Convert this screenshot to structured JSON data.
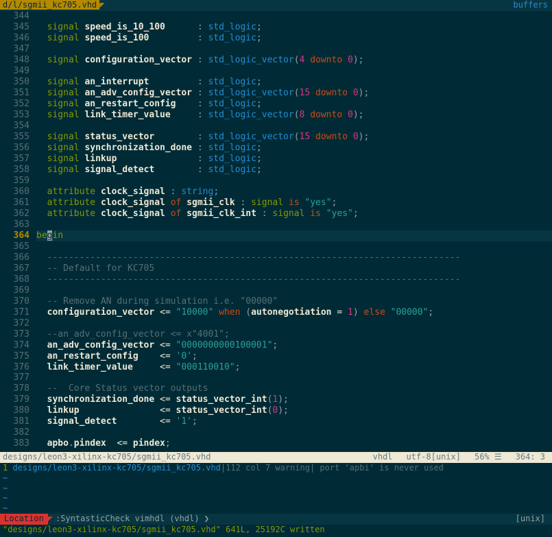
{
  "topbar": {
    "tab_label": "d/l/sgmii_kc705.vhd",
    "buffers_label": "buffers"
  },
  "lines": [
    {
      "n": 344,
      "seg": []
    },
    {
      "n": 345,
      "seg": [
        {
          "t": "  ",
          "c": ""
        },
        {
          "t": "signal",
          "c": "kw"
        },
        {
          "t": " ",
          "c": ""
        },
        {
          "t": "speed_is_10_100",
          "c": "ident"
        },
        {
          "t": "      : ",
          "c": "punc"
        },
        {
          "t": "std_logic",
          "c": "type"
        },
        {
          "t": ";",
          "c": "punc"
        }
      ]
    },
    {
      "n": 346,
      "seg": [
        {
          "t": "  ",
          "c": ""
        },
        {
          "t": "signal",
          "c": "kw"
        },
        {
          "t": " ",
          "c": ""
        },
        {
          "t": "speed_is_100",
          "c": "ident"
        },
        {
          "t": "         : ",
          "c": "punc"
        },
        {
          "t": "std_logic",
          "c": "type"
        },
        {
          "t": ";",
          "c": "punc"
        }
      ]
    },
    {
      "n": 347,
      "seg": []
    },
    {
      "n": 348,
      "seg": [
        {
          "t": "  ",
          "c": ""
        },
        {
          "t": "signal",
          "c": "kw"
        },
        {
          "t": " ",
          "c": ""
        },
        {
          "t": "configuration_vector",
          "c": "ident"
        },
        {
          "t": " : ",
          "c": "punc"
        },
        {
          "t": "std_logic_vector",
          "c": "type"
        },
        {
          "t": "(",
          "c": "punc"
        },
        {
          "t": "4",
          "c": "num"
        },
        {
          "t": " ",
          "c": ""
        },
        {
          "t": "downto",
          "c": "kw2"
        },
        {
          "t": " ",
          "c": ""
        },
        {
          "t": "0",
          "c": "num"
        },
        {
          "t": ");",
          "c": "punc"
        }
      ]
    },
    {
      "n": 349,
      "seg": []
    },
    {
      "n": 350,
      "seg": [
        {
          "t": "  ",
          "c": ""
        },
        {
          "t": "signal",
          "c": "kw"
        },
        {
          "t": " ",
          "c": ""
        },
        {
          "t": "an_interrupt",
          "c": "ident"
        },
        {
          "t": "         : ",
          "c": "punc"
        },
        {
          "t": "std_logic",
          "c": "type"
        },
        {
          "t": ";",
          "c": "punc"
        }
      ]
    },
    {
      "n": 351,
      "seg": [
        {
          "t": "  ",
          "c": ""
        },
        {
          "t": "signal",
          "c": "kw"
        },
        {
          "t": " ",
          "c": ""
        },
        {
          "t": "an_adv_config_vector",
          "c": "ident"
        },
        {
          "t": " : ",
          "c": "punc"
        },
        {
          "t": "std_logic_vector",
          "c": "type"
        },
        {
          "t": "(",
          "c": "punc"
        },
        {
          "t": "15",
          "c": "num"
        },
        {
          "t": " ",
          "c": ""
        },
        {
          "t": "downto",
          "c": "kw2"
        },
        {
          "t": " ",
          "c": ""
        },
        {
          "t": "0",
          "c": "num"
        },
        {
          "t": ");",
          "c": "punc"
        }
      ]
    },
    {
      "n": 352,
      "seg": [
        {
          "t": "  ",
          "c": ""
        },
        {
          "t": "signal",
          "c": "kw"
        },
        {
          "t": " ",
          "c": ""
        },
        {
          "t": "an_restart_config",
          "c": "ident"
        },
        {
          "t": "    : ",
          "c": "punc"
        },
        {
          "t": "std_logic",
          "c": "type"
        },
        {
          "t": ";",
          "c": "punc"
        }
      ]
    },
    {
      "n": 353,
      "seg": [
        {
          "t": "  ",
          "c": ""
        },
        {
          "t": "signal",
          "c": "kw"
        },
        {
          "t": " ",
          "c": ""
        },
        {
          "t": "link_timer_value",
          "c": "ident"
        },
        {
          "t": "     : ",
          "c": "punc"
        },
        {
          "t": "std_logic_vector",
          "c": "type"
        },
        {
          "t": "(",
          "c": "punc"
        },
        {
          "t": "8",
          "c": "num"
        },
        {
          "t": " ",
          "c": ""
        },
        {
          "t": "downto",
          "c": "kw2"
        },
        {
          "t": " ",
          "c": ""
        },
        {
          "t": "0",
          "c": "num"
        },
        {
          "t": ");",
          "c": "punc"
        }
      ]
    },
    {
      "n": 354,
      "seg": []
    },
    {
      "n": 355,
      "seg": [
        {
          "t": "  ",
          "c": ""
        },
        {
          "t": "signal",
          "c": "kw"
        },
        {
          "t": " ",
          "c": ""
        },
        {
          "t": "status_vector",
          "c": "ident"
        },
        {
          "t": "        : ",
          "c": "punc"
        },
        {
          "t": "std_logic_vector",
          "c": "type"
        },
        {
          "t": "(",
          "c": "punc"
        },
        {
          "t": "15",
          "c": "num"
        },
        {
          "t": " ",
          "c": ""
        },
        {
          "t": "downto",
          "c": "kw2"
        },
        {
          "t": " ",
          "c": ""
        },
        {
          "t": "0",
          "c": "num"
        },
        {
          "t": ");",
          "c": "punc"
        }
      ]
    },
    {
      "n": 356,
      "seg": [
        {
          "t": "  ",
          "c": ""
        },
        {
          "t": "signal",
          "c": "kw"
        },
        {
          "t": " ",
          "c": ""
        },
        {
          "t": "synchronization_done",
          "c": "ident"
        },
        {
          "t": " : ",
          "c": "punc"
        },
        {
          "t": "std_logic",
          "c": "type"
        },
        {
          "t": ";",
          "c": "punc"
        }
      ]
    },
    {
      "n": 357,
      "seg": [
        {
          "t": "  ",
          "c": ""
        },
        {
          "t": "signal",
          "c": "kw"
        },
        {
          "t": " ",
          "c": ""
        },
        {
          "t": "linkup",
          "c": "ident"
        },
        {
          "t": "               : ",
          "c": "punc"
        },
        {
          "t": "std_logic",
          "c": "type"
        },
        {
          "t": ";",
          "c": "punc"
        }
      ]
    },
    {
      "n": 358,
      "seg": [
        {
          "t": "  ",
          "c": ""
        },
        {
          "t": "signal",
          "c": "kw"
        },
        {
          "t": " ",
          "c": ""
        },
        {
          "t": "signal_detect",
          "c": "ident"
        },
        {
          "t": "        : ",
          "c": "punc"
        },
        {
          "t": "std_logic",
          "c": "type"
        },
        {
          "t": ";",
          "c": "punc"
        }
      ]
    },
    {
      "n": 359,
      "seg": []
    },
    {
      "n": 360,
      "seg": [
        {
          "t": "  ",
          "c": ""
        },
        {
          "t": "attribute",
          "c": "kw"
        },
        {
          "t": " ",
          "c": ""
        },
        {
          "t": "clock_signal",
          "c": "ident"
        },
        {
          "t": " : ",
          "c": "punc"
        },
        {
          "t": "string",
          "c": "type"
        },
        {
          "t": ";",
          "c": "punc"
        }
      ]
    },
    {
      "n": 361,
      "seg": [
        {
          "t": "  ",
          "c": ""
        },
        {
          "t": "attribute",
          "c": "kw"
        },
        {
          "t": " ",
          "c": ""
        },
        {
          "t": "clock_signal",
          "c": "ident"
        },
        {
          "t": " ",
          "c": ""
        },
        {
          "t": "of",
          "c": "kw2"
        },
        {
          "t": " ",
          "c": ""
        },
        {
          "t": "sgmii_clk",
          "c": "ident"
        },
        {
          "t": " : ",
          "c": "punc"
        },
        {
          "t": "signal",
          "c": "kw"
        },
        {
          "t": " ",
          "c": ""
        },
        {
          "t": "is",
          "c": "kw2"
        },
        {
          "t": " ",
          "c": ""
        },
        {
          "t": "\"yes\"",
          "c": "str"
        },
        {
          "t": ";",
          "c": "punc"
        }
      ]
    },
    {
      "n": 362,
      "seg": [
        {
          "t": "  ",
          "c": ""
        },
        {
          "t": "attribute",
          "c": "kw"
        },
        {
          "t": " ",
          "c": ""
        },
        {
          "t": "clock_signal",
          "c": "ident"
        },
        {
          "t": " ",
          "c": ""
        },
        {
          "t": "of",
          "c": "kw2"
        },
        {
          "t": " ",
          "c": ""
        },
        {
          "t": "sgmii_clk_int",
          "c": "ident"
        },
        {
          "t": " : ",
          "c": "punc"
        },
        {
          "t": "signal",
          "c": "kw"
        },
        {
          "t": " ",
          "c": ""
        },
        {
          "t": "is",
          "c": "kw2"
        },
        {
          "t": " ",
          "c": ""
        },
        {
          "t": "\"yes\"",
          "c": "str"
        },
        {
          "t": ";",
          "c": "punc"
        }
      ]
    },
    {
      "n": 363,
      "seg": []
    },
    {
      "n": 364,
      "current": true,
      "seg": [
        {
          "t": "be",
          "c": "kw"
        },
        {
          "t": "g",
          "c": "cursor"
        },
        {
          "t": "in",
          "c": "kw"
        }
      ]
    },
    {
      "n": 365,
      "seg": []
    },
    {
      "n": 366,
      "seg": [
        {
          "t": "  -----------------------------------------------------------------------------",
          "c": "comment"
        }
      ]
    },
    {
      "n": 367,
      "seg": [
        {
          "t": "  -- Default for KC705",
          "c": "comment"
        }
      ]
    },
    {
      "n": 368,
      "seg": [
        {
          "t": "  -----------------------------------------------------------------------------",
          "c": "comment"
        }
      ]
    },
    {
      "n": 369,
      "seg": []
    },
    {
      "n": 370,
      "seg": [
        {
          "t": "  -- Remove AN during simulation i.e. \"00000\"",
          "c": "comment"
        }
      ]
    },
    {
      "n": 371,
      "seg": [
        {
          "t": "  ",
          "c": ""
        },
        {
          "t": "configuration_vector",
          "c": "ident"
        },
        {
          "t": " <= ",
          "c": "op"
        },
        {
          "t": "\"10000\"",
          "c": "str"
        },
        {
          "t": " ",
          "c": ""
        },
        {
          "t": "when",
          "c": "kw2"
        },
        {
          "t": " (",
          "c": "punc"
        },
        {
          "t": "autonegotiation",
          "c": "ident"
        },
        {
          "t": " = ",
          "c": "op"
        },
        {
          "t": "1",
          "c": "num"
        },
        {
          "t": ") ",
          "c": "punc"
        },
        {
          "t": "else",
          "c": "kw2"
        },
        {
          "t": " ",
          "c": ""
        },
        {
          "t": "\"00000\"",
          "c": "str"
        },
        {
          "t": ";",
          "c": "punc"
        }
      ]
    },
    {
      "n": 372,
      "seg": []
    },
    {
      "n": 373,
      "seg": [
        {
          "t": "  --an_adv_config_vector <= x\"4001\";",
          "c": "comment"
        }
      ]
    },
    {
      "n": 374,
      "seg": [
        {
          "t": "  ",
          "c": ""
        },
        {
          "t": "an_adv_config_vector",
          "c": "ident"
        },
        {
          "t": " <= ",
          "c": "op"
        },
        {
          "t": "\"0000000000100001\"",
          "c": "str"
        },
        {
          "t": ";",
          "c": "punc"
        }
      ]
    },
    {
      "n": 375,
      "seg": [
        {
          "t": "  ",
          "c": ""
        },
        {
          "t": "an_restart_config",
          "c": "ident"
        },
        {
          "t": "    <= ",
          "c": "op"
        },
        {
          "t": "'0'",
          "c": "str"
        },
        {
          "t": ";",
          "c": "punc"
        }
      ]
    },
    {
      "n": 376,
      "seg": [
        {
          "t": "  ",
          "c": ""
        },
        {
          "t": "link_timer_value",
          "c": "ident"
        },
        {
          "t": "     <= ",
          "c": "op"
        },
        {
          "t": "\"000110010\"",
          "c": "str"
        },
        {
          "t": ";",
          "c": "punc"
        }
      ]
    },
    {
      "n": 377,
      "seg": []
    },
    {
      "n": 378,
      "seg": [
        {
          "t": "  --  Core Status vector outputs",
          "c": "comment"
        }
      ]
    },
    {
      "n": 379,
      "seg": [
        {
          "t": "  ",
          "c": ""
        },
        {
          "t": "synchronization_done",
          "c": "ident"
        },
        {
          "t": " <= ",
          "c": "op"
        },
        {
          "t": "status_vector_int",
          "c": "ident"
        },
        {
          "t": "(",
          "c": "punc"
        },
        {
          "t": "1",
          "c": "num"
        },
        {
          "t": ");",
          "c": "punc"
        }
      ]
    },
    {
      "n": 380,
      "seg": [
        {
          "t": "  ",
          "c": ""
        },
        {
          "t": "linkup",
          "c": "ident"
        },
        {
          "t": "               <= ",
          "c": "op"
        },
        {
          "t": "status_vector_int",
          "c": "ident"
        },
        {
          "t": "(",
          "c": "punc"
        },
        {
          "t": "0",
          "c": "num"
        },
        {
          "t": ");",
          "c": "punc"
        }
      ]
    },
    {
      "n": 381,
      "seg": [
        {
          "t": "  ",
          "c": ""
        },
        {
          "t": "signal_detect",
          "c": "ident"
        },
        {
          "t": "        <= ",
          "c": "op"
        },
        {
          "t": "'1'",
          "c": "str"
        },
        {
          "t": ";",
          "c": "punc"
        }
      ]
    },
    {
      "n": 382,
      "seg": []
    },
    {
      "n": 383,
      "seg": [
        {
          "t": "  ",
          "c": ""
        },
        {
          "t": "apbo",
          "c": "ident"
        },
        {
          "t": ".",
          "c": "punc"
        },
        {
          "t": "pindex",
          "c": "ident"
        },
        {
          "t": "  <= ",
          "c": "op"
        },
        {
          "t": "pindex",
          "c": "ident"
        },
        {
          "t": ";",
          "c": "punc"
        }
      ]
    }
  ],
  "status": {
    "path": "designs/leon3-xilinx-kc705/sgmii_kc705.vhd",
    "filetype": "vhdl",
    "encoding": "utf-8[unix]",
    "percent": "56% ☰",
    "pos": "364:  3"
  },
  "loclist": {
    "num": "1",
    "path": "designs/leon3-xilinx-kc705/sgmii_kc705.vhd",
    "info": "|112 col 7 warning| port 'apbi' is never used"
  },
  "locstatus": {
    "label": "Location",
    "cmd": ":SyntasticCheck vimhdl (vhdl) ❯",
    "unix": "[unix]"
  },
  "cmdline": "\"designs/leon3-xilinx-kc705/sgmii_kc705.vhd\" 641L, 25192C written"
}
